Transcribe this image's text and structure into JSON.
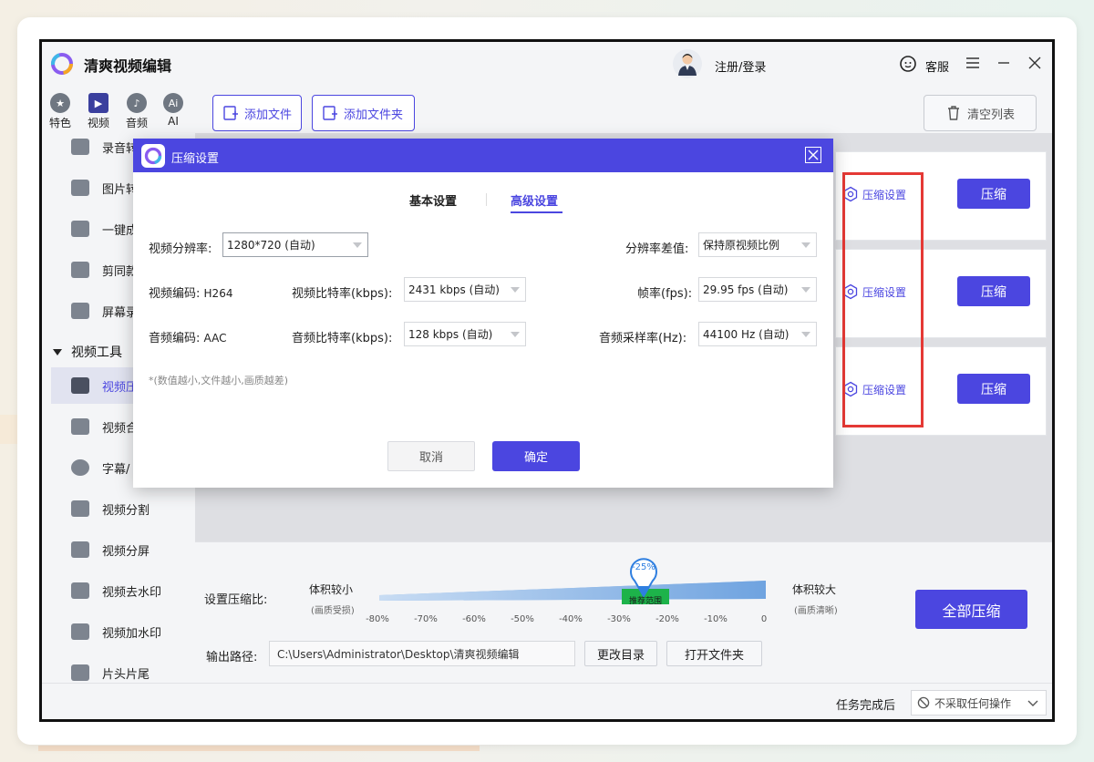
{
  "app": {
    "title": "清爽视频编辑",
    "login": "注册/登录",
    "support": "客服"
  },
  "category_tabs": [
    {
      "label": "特色",
      "icon": "star-icon"
    },
    {
      "label": "视频",
      "icon": "film-icon"
    },
    {
      "label": "音频",
      "icon": "music-icon"
    },
    {
      "label": "AI",
      "icon": "ai-icon"
    }
  ],
  "sidebar": {
    "items": [
      {
        "label": "录音转"
      },
      {
        "label": "图片转"
      },
      {
        "label": "一键成"
      },
      {
        "label": "剪同款"
      },
      {
        "label": "屏幕录"
      }
    ],
    "group": "视频工具",
    "tools": [
      {
        "label": "视频压"
      },
      {
        "label": "视频合"
      },
      {
        "label": "字幕/"
      },
      {
        "label": "视频分割"
      },
      {
        "label": "视频分屏"
      },
      {
        "label": "视频去水印"
      },
      {
        "label": "视频加水印"
      },
      {
        "label": "片头片尾"
      }
    ]
  },
  "toolbar": {
    "add_file": "添加文件",
    "add_folder": "添加文件夹",
    "clear_list": "清空列表"
  },
  "file_rows": [
    {
      "settings": "压缩设置",
      "compress": "压缩"
    },
    {
      "settings": "压缩设置",
      "compress": "压缩"
    },
    {
      "settings": "压缩设置",
      "compress": "压缩"
    }
  ],
  "compression": {
    "label": "设置压缩比:",
    "small_title": "体积较小",
    "small_sub": "(画质受损)",
    "large_title": "体积较大",
    "large_sub": "(画质清晰)",
    "current": "-25%",
    "current_value": -25,
    "recommended": "推荐范围",
    "ticks": [
      "-80%",
      "-70%",
      "-60%",
      "-50%",
      "-40%",
      "-30%",
      "-20%",
      "-10%",
      "0"
    ],
    "compress_all": "全部压缩"
  },
  "output": {
    "label": "输出路径:",
    "path": "C:\\Users\\Administrator\\Desktop\\清爽视频编辑",
    "change_dir": "更改目录",
    "open_folder": "打开文件夹"
  },
  "status": {
    "after_label": "任务完成后",
    "after_value": "不采取任何操作"
  },
  "dialog": {
    "title": "压缩设置",
    "tabs": [
      "基本设置",
      "高级设置"
    ],
    "active_tab": "高级设置",
    "resolution_label": "视频分辨率:",
    "resolution_value": "1280*720 (自动)",
    "diff_label": "分辨率差值:",
    "diff_value": "保持原视频比例",
    "vcodec_label": "视频编码:",
    "vcodec_value": "H264",
    "vbitrate_label": "视频比特率(kbps):",
    "vbitrate_value": "2431 kbps (自动)",
    "fps_label": "帧率(fps):",
    "fps_value": "29.95 fps (自动)",
    "acodec_label": "音频编码:",
    "acodec_value": "AAC",
    "abitrate_label": "音频比特率(kbps):",
    "abitrate_value": "128 kbps (自动)",
    "samplerate_label": "音频采样率(Hz):",
    "samplerate_value": "44100 Hz (自动)",
    "note": "*(数值越小,文件越小,画质越差)",
    "cancel": "取消",
    "confirm": "确定"
  },
  "colors": {
    "accent": "#4b46e0",
    "annotation": "#e53935"
  }
}
